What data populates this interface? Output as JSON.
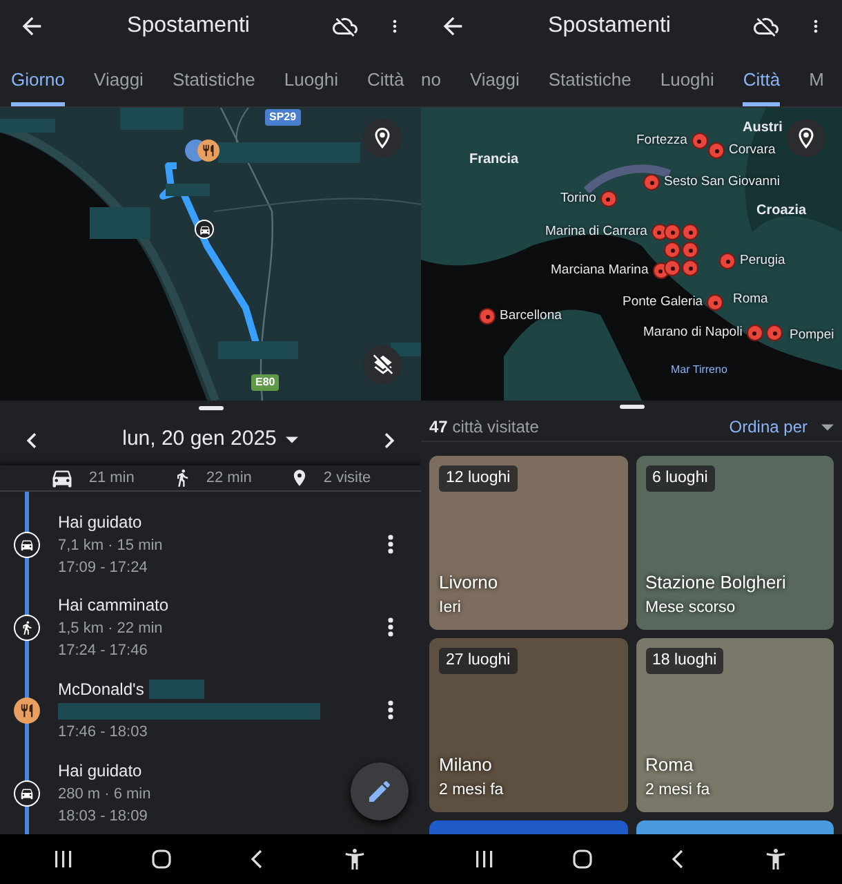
{
  "left": {
    "app_bar": {
      "title": "Spostamenti"
    },
    "tabs": [
      {
        "label": "Giorno",
        "selected": true
      },
      {
        "label": "Viaggi",
        "selected": false
      },
      {
        "label": "Statistiche",
        "selected": false
      },
      {
        "label": "Luoghi",
        "selected": false
      },
      {
        "label": "Città",
        "selected": false
      }
    ],
    "map": {
      "road_labels": [
        {
          "label": "SP29",
          "color": "#4a7fd0"
        },
        {
          "label": "E80",
          "color": "#5f9a4a"
        }
      ]
    },
    "date_bar": {
      "date": "lun, 20 gen 2025"
    },
    "summary": [
      {
        "kind": "car",
        "text": "21 min"
      },
      {
        "kind": "walk",
        "text": "22 min"
      },
      {
        "kind": "place",
        "text": "2 visite"
      }
    ],
    "timeline": [
      {
        "kind": "drive",
        "title": "Hai guidato",
        "detail": "7,1 km · 15 min",
        "time": "17:09 - 17:24"
      },
      {
        "kind": "walk",
        "title": "Hai camminato",
        "detail": "1,5 km · 22 min",
        "time": "17:24 - 17:46"
      },
      {
        "kind": "place",
        "title": "McDonald's",
        "time": "17:46 - 18:03"
      },
      {
        "kind": "drive",
        "title": "Hai guidato",
        "detail": "280 m · 6 min",
        "time": "18:03 - 18:09"
      }
    ]
  },
  "right": {
    "app_bar": {
      "title": "Spostamenti"
    },
    "tabs": [
      {
        "label": "no",
        "selected": false
      },
      {
        "label": "Viaggi",
        "selected": false
      },
      {
        "label": "Statistiche",
        "selected": false
      },
      {
        "label": "Luoghi",
        "selected": false
      },
      {
        "label": "Città",
        "selected": true
      },
      {
        "label": "M",
        "selected": false
      }
    ],
    "map": {
      "regions": [
        "Francia",
        "Austri",
        "Croazia"
      ],
      "sea": "Mar Tirreno",
      "pins": [
        {
          "label": "Fortezza"
        },
        {
          "label": "Corvara"
        },
        {
          "label": "Sesto San Giovanni"
        },
        {
          "label": "Torino"
        },
        {
          "label": "Marina di Carrara"
        },
        {
          "label": "Perugia"
        },
        {
          "label": "Marciana Marina"
        },
        {
          "label": "Ponte Galeria"
        },
        {
          "label": "Roma"
        },
        {
          "label": "Marano di Napoli"
        },
        {
          "label": "Pompei"
        },
        {
          "label": "Barcellona"
        }
      ]
    },
    "count": {
      "number": "47",
      "text": "città visitate"
    },
    "sort": {
      "label": "Ordina per"
    },
    "cities": [
      {
        "badge": "12 luoghi",
        "name": "Livorno",
        "when": "Ieri"
      },
      {
        "badge": "6 luoghi",
        "name": "Stazione Bolgheri",
        "when": "Mese scorso"
      },
      {
        "badge": "27 luoghi",
        "name": "Milano",
        "when": "2 mesi fa"
      },
      {
        "badge": "18 luoghi",
        "name": "Roma",
        "when": "2 mesi fa"
      }
    ]
  }
}
